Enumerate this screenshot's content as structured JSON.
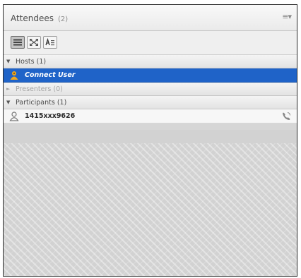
{
  "pod": {
    "title": "Attendees",
    "count": "(2)",
    "menu_icon": "pod-options-menu-icon"
  },
  "toolbar": {
    "buttons": [
      {
        "name": "list-view-button",
        "icon": "list-icon",
        "active": true
      },
      {
        "name": "fullscreen-view-button",
        "icon": "expand-arrows-icon",
        "active": false
      },
      {
        "name": "sort-button",
        "icon": "sort-az-icon",
        "active": false
      }
    ]
  },
  "sections": {
    "hosts": {
      "label": "Hosts (1)",
      "expanded": true
    },
    "presenters": {
      "label": "Presenters (0)",
      "expanded": false
    },
    "participants": {
      "label": "Participants (1)",
      "expanded": true
    }
  },
  "hosts": [
    {
      "name": "Connect User",
      "icon": "host-person-icon",
      "selected": true
    }
  ],
  "participants": [
    {
      "name": "1415xxx9626",
      "icon": "participant-person-icon",
      "status_icon": "phone-icon"
    }
  ],
  "colors": {
    "selection": "#1f63c8",
    "host_icon": "#f2a81d",
    "panel_bg": "#d2d2d2"
  }
}
